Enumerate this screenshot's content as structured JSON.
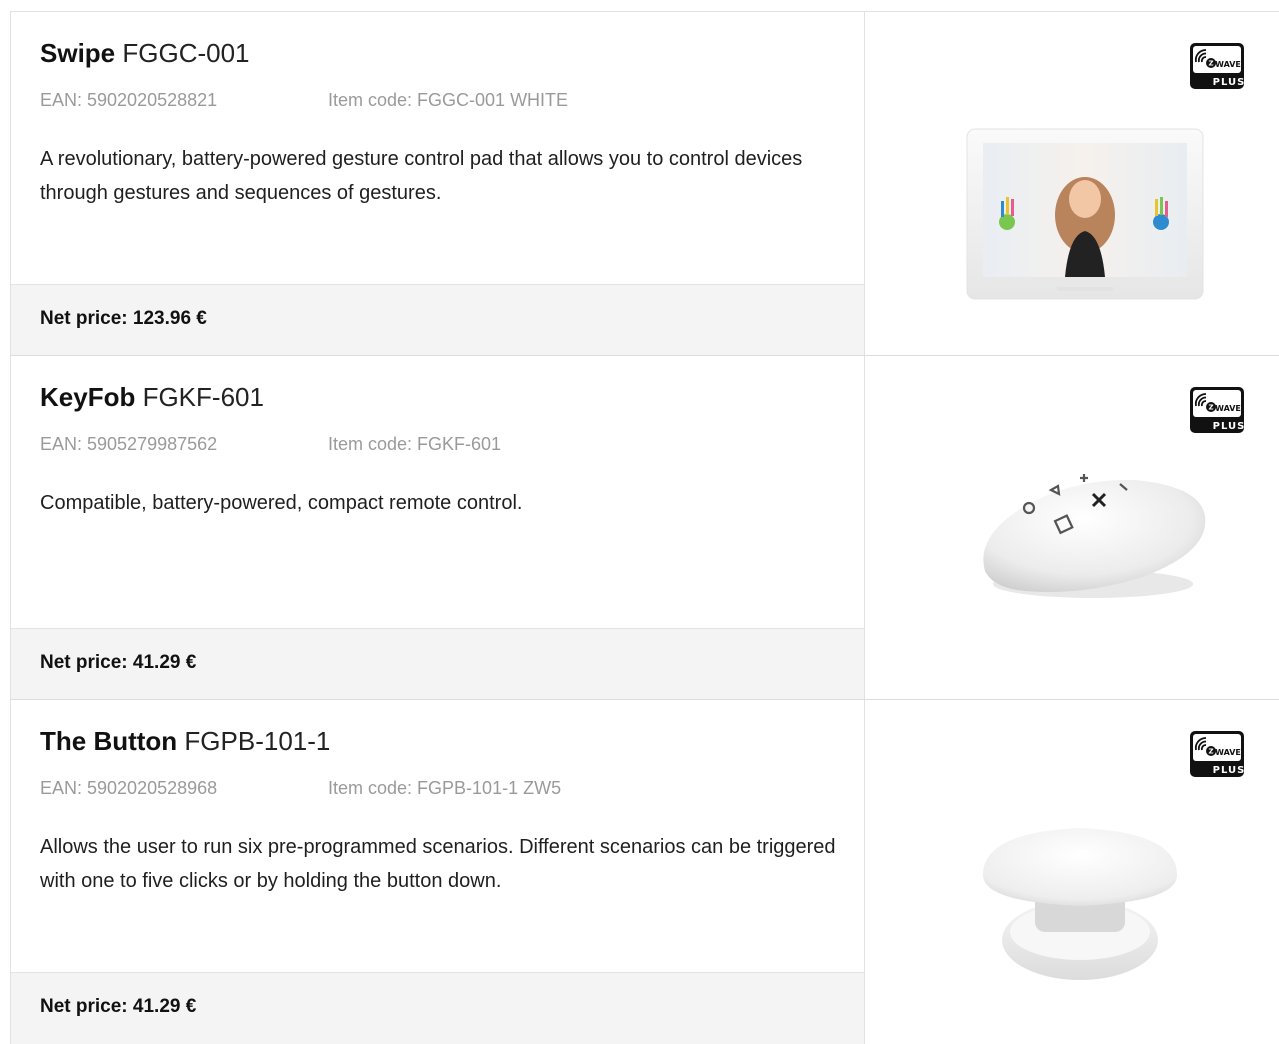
{
  "products": [
    {
      "name": "Swipe",
      "model": "FGGC-001",
      "ean": "EAN: 5902020528821",
      "item_code": "Item code: FGGC-001 WHITE",
      "description": "A revolutionary, battery-powered gesture control pad that allows you to control devices through gestures and sequences of gestures.",
      "price": "Net price:  123.96 €",
      "badge_icon": "zwave-plus-icon",
      "image_icon": "swipe-product-image"
    },
    {
      "name": "KeyFob",
      "model": "FGKF-601",
      "ean": "EAN: 5905279987562",
      "item_code": "Item code: FGKF-601",
      "description": "Compatible, battery-powered, compact remote control.",
      "price": "Net price:  41.29 €",
      "badge_icon": "zwave-plus-icon",
      "image_icon": "keyfob-product-image"
    },
    {
      "name": "The Button",
      "model": "FGPB-101-1",
      "ean": "EAN: 5902020528968",
      "item_code": "Item code: FGPB-101-1 ZW5",
      "description": "Allows the user to run six pre-programmed scenarios. Different scenarios can be triggered with one to five clicks or by holding the button down.",
      "price": "Net price:  41.29 €",
      "badge_icon": "zwave-plus-icon",
      "image_icon": "button-product-image"
    }
  ],
  "badge": {
    "top": "WAVE",
    "bottom": "PLUS"
  }
}
